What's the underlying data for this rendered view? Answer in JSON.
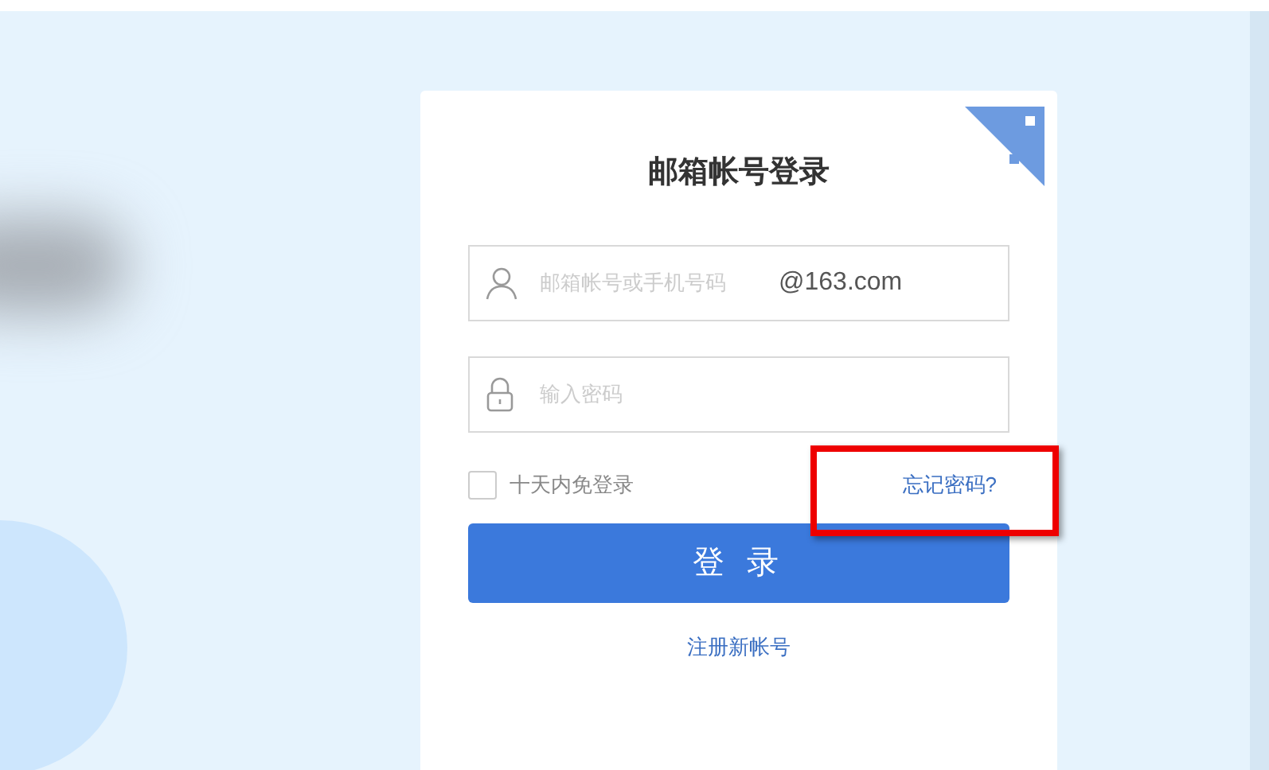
{
  "login_card": {
    "title": "邮箱帐号登录",
    "username_field": {
      "placeholder": "邮箱帐号或手机号码",
      "suffix": "@163.com"
    },
    "password_field": {
      "placeholder": "输入密码"
    },
    "remember": {
      "label": "十天内免登录",
      "checked": false
    },
    "forgot_link": {
      "text": "忘记密码?",
      "highlighted": true
    },
    "login_button": "登 录",
    "register_link": "注册新帐号"
  }
}
